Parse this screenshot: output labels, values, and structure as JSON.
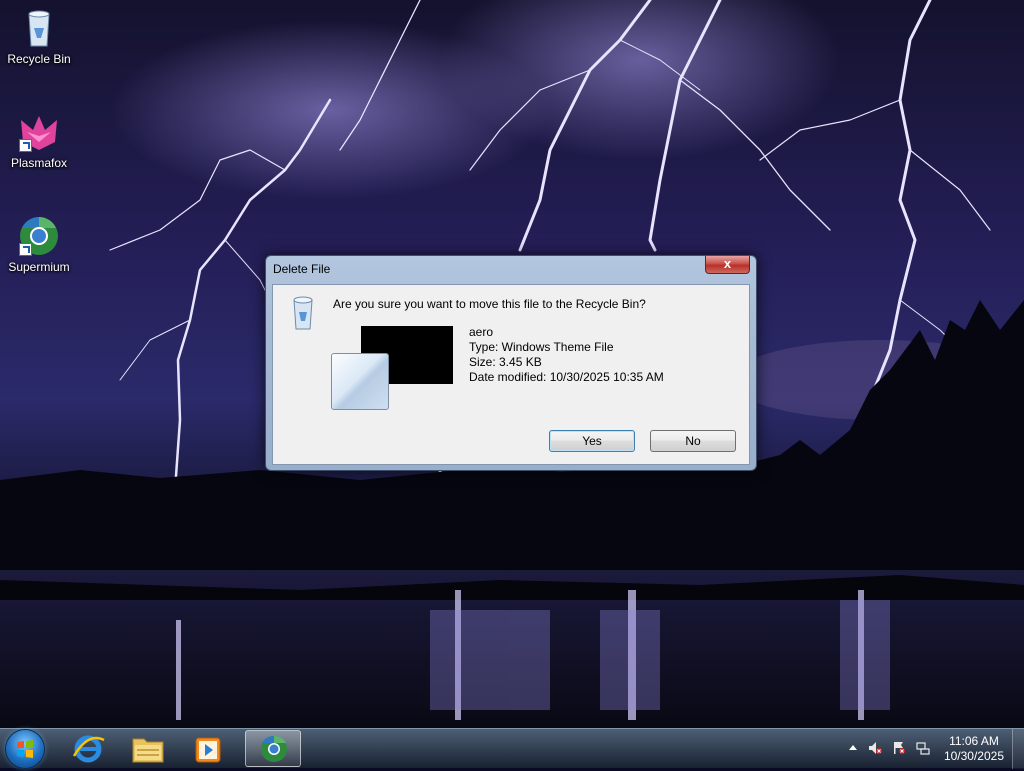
{
  "desktop": {
    "icons": [
      {
        "label": "Recycle Bin"
      },
      {
        "label": "Plasmafox"
      },
      {
        "label": "Supermium"
      }
    ]
  },
  "dialog": {
    "title": "Delete File",
    "close_label": "x",
    "question": "Are you sure you want to move this file to the Recycle Bin?",
    "file": {
      "name": "aero",
      "type": "Type: Windows Theme File",
      "size": "Size: 3.45 KB",
      "modified": "Date modified: 10/30/2025 10:35 AM"
    },
    "yes_label": "Yes",
    "no_label": "No"
  },
  "taskbar": {
    "pinned": [
      {
        "icon": "internet-explorer-icon"
      },
      {
        "icon": "file-explorer-icon"
      },
      {
        "icon": "media-player-icon"
      },
      {
        "icon": "supermium-icon",
        "active": true
      }
    ],
    "clock": {
      "time": "11:06 AM",
      "date": "10/30/2025"
    }
  },
  "colors": {
    "dialog_frame": "#a6b9d4",
    "close_button": "#c9524a",
    "taskbar": "#1c2838"
  }
}
